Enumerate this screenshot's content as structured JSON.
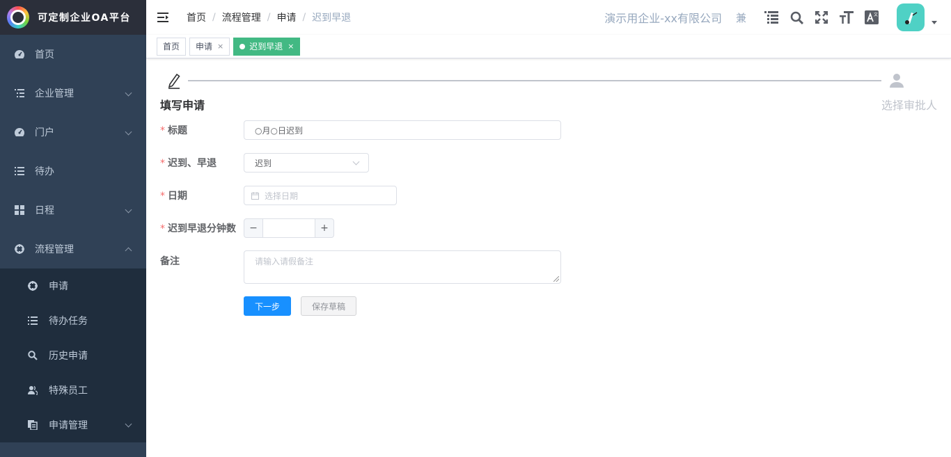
{
  "app": {
    "title": "可定制企业OA平台"
  },
  "sidebar": {
    "items": [
      {
        "label": "首页",
        "icon": "dashboard-icon"
      },
      {
        "label": "企业管理",
        "icon": "tree-list-icon",
        "expandable": true
      },
      {
        "label": "门户",
        "icon": "dashboard-icon",
        "expandable": true
      },
      {
        "label": "待办",
        "icon": "list-icon"
      },
      {
        "label": "日程",
        "icon": "grid-icon",
        "expandable": true
      },
      {
        "label": "流程管理",
        "icon": "target-icon",
        "expandable": true,
        "expanded": true
      }
    ],
    "sub_items": [
      {
        "label": "申请",
        "icon": "target-icon"
      },
      {
        "label": "待办任务",
        "icon": "list-icon"
      },
      {
        "label": "历史申请",
        "icon": "search-icon"
      },
      {
        "label": "特殊员工",
        "icon": "peoples-icon"
      },
      {
        "label": "申请管理",
        "icon": "documents-icon",
        "expandable": true
      }
    ]
  },
  "navbar": {
    "breadcrumb": [
      "首页",
      "流程管理",
      "申请",
      "迟到早退"
    ],
    "company": "演示用企业-xx有限公司",
    "char_icon": "兼"
  },
  "tags": [
    {
      "label": "首页",
      "closable": false,
      "active": false
    },
    {
      "label": "申请",
      "closable": true,
      "active": false
    },
    {
      "label": "迟到早退",
      "closable": true,
      "active": true
    }
  ],
  "tag_close": "×",
  "steps": [
    {
      "title": "填写申请",
      "status": "process",
      "icon": "edit-icon"
    },
    {
      "title": "选择审批人",
      "status": "wait",
      "icon": "user-icon"
    }
  ],
  "form": {
    "title_label": "标题",
    "title_value": "○月○日迟到",
    "type_label": "迟到、早退",
    "type_value": "迟到",
    "date_label": "日期",
    "date_placeholder": "选择日期",
    "minutes_label": "迟到早退分钟数",
    "minus": "−",
    "plus": "+",
    "remark_label": "备注",
    "remark_placeholder": "请输入请假备注",
    "required_mark": "*"
  },
  "buttons": {
    "next": "下一步",
    "save_draft": "保存草稿"
  },
  "colors": {
    "sidebar_bg": "#304156",
    "submenu_bg": "#1f2d3d",
    "tag_active": "#42b983",
    "primary": "#1890ff",
    "required": "#f56c6c"
  }
}
